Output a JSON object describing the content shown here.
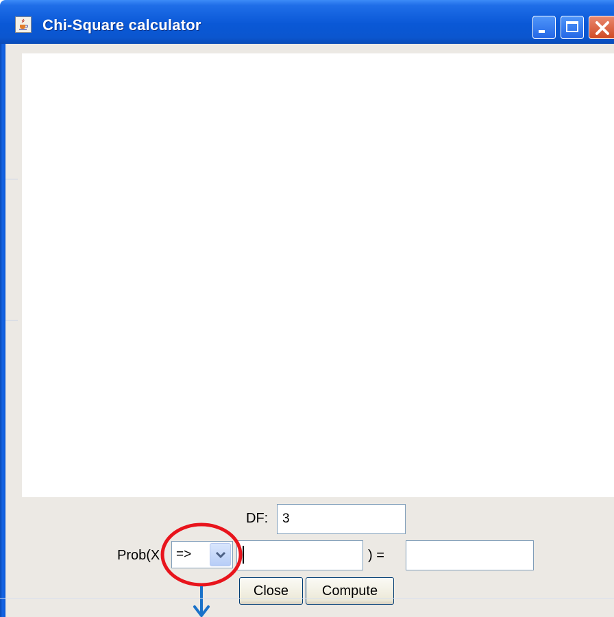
{
  "window": {
    "title": "Chi-Square calculator",
    "icon": "java-cup-icon",
    "controls": [
      "minimize-icon",
      "maximize-icon",
      "close-icon"
    ]
  },
  "form": {
    "df_label": "DF:",
    "df_value": "3",
    "prob_label_prefix": "Prob(X",
    "operator_selected": "=>",
    "x_value": "",
    "equals_label": ") =",
    "result_value": ""
  },
  "buttons": {
    "close_label": "Close",
    "compute_label": "Compute"
  },
  "annotation": {
    "highlight_color": "#e8141c",
    "arrow_color": "#1a72c9"
  },
  "colors": {
    "titlebar": "#0a58d6",
    "panel": "#ece9e4",
    "field_border": "#7f9db9"
  }
}
